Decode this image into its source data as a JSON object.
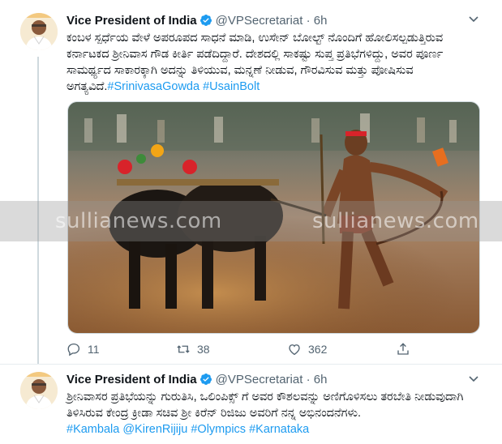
{
  "tweets": [
    {
      "author_name": "Vice President of India",
      "handle": "@VPSecretariat",
      "separator": "·",
      "time": "6h",
      "text_plain": "ಕಂಬಳ ಸ್ಪರ್ಧೆಯ ವೇಳೆ ಅಪರೂಪದ ಸಾಧನೆ ಮಾಡಿ, ಉಸೇನ್ ಬೋಲ್ಟ್ ನೊಂದಿಗೆ ಹೋಲಿಸಲ್ಪಡುತ್ತಿರುವ ಕರ್ನಾಟಕದ ಶ್ರೀನಿವಾಸ ಗೌಡ ಕೀರ್ತಿ ಪಡೆದಿದ್ದಾರೆ. ದೇಶದಲ್ಲಿ ಸಾಕಷ್ಟು ಸುಪ್ತ ಪ್ರತಿಭೆಗಳಿದ್ದು, ಅವರ ಪೂರ್ಣ ಸಾಮರ್ಥ್ಯದ ಸಾಕಾರಕ್ಕಾಗಿ ಅದನ್ನು ತಿಳಿಯುವ, ಮನ್ನಣೆ ನೀಡುವ, ಗೌರವಿಸುವ ಮತ್ತು ಪೋಷಿಸುವ ಅಗತ್ಯವಿದೆ.",
      "hashtags": [
        "#SrinivasaGowda",
        "#UsainBolt"
      ],
      "replies": "11",
      "retweets": "38",
      "likes": "362"
    },
    {
      "author_name": "Vice President of India",
      "handle": "@VPSecretariat",
      "separator": "·",
      "time": "6h",
      "text_plain": "ಶ್ರೀನಿವಾಸರ ಪ್ರತಿಭೆಯನ್ನು ಗುರುತಿಸಿ, ಒಲಿಂಪಿಕ್ಸ್ ಗೆ ಅವರ ಕೌಶಲವನ್ನು ಅಣಿಗೊಳಿಸಲು ತರಬೇತಿ ನೀಡುವುದಾಗಿ ತಿಳಿಸಿರುವ ಕೇಂದ್ರ ಕ್ರೀಡಾ ಸಚಿವ ಶ್ರೀ ಕಿರೆನ್ ರಿಜಿಜು ಅವರಿಗೆ ನನ್ನ ಅಭಿನಂದನೆಗಳು.",
      "tags": [
        "#Kambala",
        "@KirenRijiju",
        "#Olympics",
        "#Karnataka"
      ]
    }
  ],
  "watermark": [
    "sullianews.com",
    "sullianews.com"
  ],
  "colors": {
    "link": "#1d9bf0",
    "muted": "#536471",
    "verified": "#1d9bf0"
  },
  "icons": [
    "reply-icon",
    "retweet-icon",
    "like-icon",
    "share-icon",
    "verified-badge-icon",
    "chevron-down-icon"
  ]
}
